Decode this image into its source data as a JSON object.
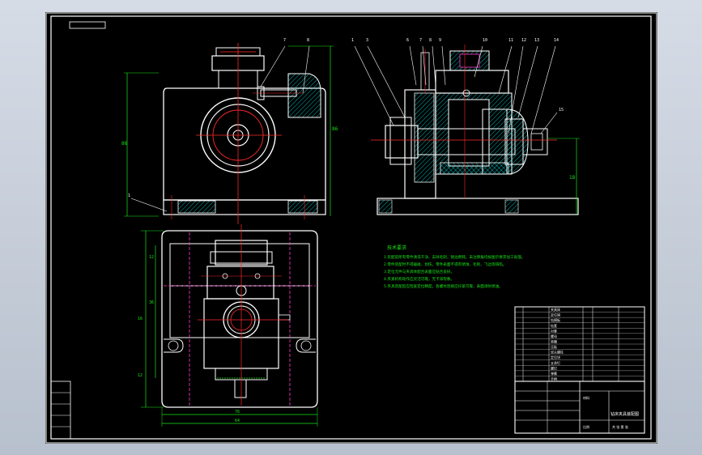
{
  "drawing": {
    "colors": {
      "background": "#000000",
      "outline": "#ffffff",
      "dimension": "#19e619",
      "centerline": "#ff2a2a",
      "hatch": "#00e0e0",
      "hidden": "#ff3ccf",
      "leader": "#ffffff",
      "notes": "#19e619"
    },
    "top_left_box_label": "",
    "front_view": {
      "height_dim": "86",
      "side_dim": "86",
      "callouts": [
        "7",
        "8"
      ],
      "base_callout": "1"
    },
    "section_view": {
      "callouts": [
        "1",
        "3",
        "6",
        "7",
        "8",
        "9",
        "10",
        "11",
        "12",
        "13",
        "14"
      ],
      "sub_callout": "15",
      "right_dim": "18"
    },
    "top_view": {
      "width_dim_outer": "76",
      "width_dim_inner": "64",
      "left_dims": [
        "12",
        "36",
        "16",
        "12"
      ]
    },
    "notes": {
      "heading": "技术要求",
      "lines": [
        "1.装配前所有零件清洗干净，去除毛刺，锐边倒钝，未注倒角均按图示要求加工处理。",
        "2.零件装配时不得磕碰、划伤，零件表面不得有锈蚀、毛刺、飞边等缺陷。",
        "3.定位元件与夹具体配合表面应贴合良好。",
        "4.夹紧机构动作应灵活可靠，无卡滞现象。",
        "5.夹具装配后应检查定位精度，各螺纹连接应拧紧可靠，表面涂防锈油。"
      ]
    },
    "title_block": {
      "drawing_name": "钻床夹具装配图",
      "material_label": "材料",
      "scale_label": "比例",
      "sheet_label": "共 张 第 张"
    },
    "parts_list": [
      "夹具体",
      "定位销",
      "钻模板",
      "钻套",
      "衬套",
      "螺母",
      "垫圈",
      "压板",
      "双头螺柱",
      "定位块",
      "支承钉",
      "螺钉",
      "弹簧",
      "手柄"
    ]
  }
}
